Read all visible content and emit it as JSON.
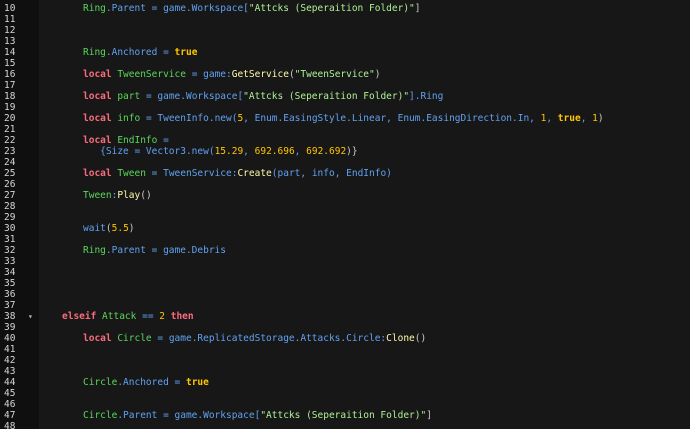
{
  "editor": {
    "lines": [
      {
        "n": "10",
        "tokens": [
          {
            "t": "Ring",
            "c": "idg"
          },
          {
            "t": ".Parent = game.Workspace[",
            "c": "prop"
          },
          {
            "t": "\"Attcks (Seperaition Folder)\"",
            "c": "str"
          },
          {
            "t": "]",
            "c": "punc"
          }
        ]
      },
      {
        "n": "11",
        "tokens": []
      },
      {
        "n": "12",
        "tokens": []
      },
      {
        "n": "13",
        "tokens": []
      },
      {
        "n": "14",
        "tokens": [
          {
            "t": "Ring",
            "c": "idg"
          },
          {
            "t": ".Anchored = ",
            "c": "prop"
          },
          {
            "t": "true",
            "c": "bool"
          }
        ]
      },
      {
        "n": "15",
        "tokens": []
      },
      {
        "n": "16",
        "tokens": [
          {
            "t": "local ",
            "c": "kw"
          },
          {
            "t": "TweenService",
            "c": "idg"
          },
          {
            "t": " = game:",
            "c": "prop"
          },
          {
            "t": "GetService",
            "c": "fn"
          },
          {
            "t": "(",
            "c": "punc"
          },
          {
            "t": "\"TweenService\"",
            "c": "str"
          },
          {
            "t": ")",
            "c": "punc"
          }
        ]
      },
      {
        "n": "17",
        "tokens": []
      },
      {
        "n": "18",
        "tokens": [
          {
            "t": "local ",
            "c": "kw"
          },
          {
            "t": "part",
            "c": "idg"
          },
          {
            "t": " = game.Workspace[",
            "c": "prop"
          },
          {
            "t": "\"Attcks (Seperaition Folder)\"",
            "c": "str"
          },
          {
            "t": "].Ring",
            "c": "prop"
          }
        ]
      },
      {
        "n": "19",
        "tokens": []
      },
      {
        "n": "20",
        "tokens": [
          {
            "t": "local ",
            "c": "kw"
          },
          {
            "t": "info",
            "c": "idg"
          },
          {
            "t": " = TweenInfo.new(",
            "c": "prop"
          },
          {
            "t": "5",
            "c": "num"
          },
          {
            "t": ", Enum.EasingStyle.Linear, Enum.EasingDirection.In, ",
            "c": "prop"
          },
          {
            "t": "1",
            "c": "num"
          },
          {
            "t": ", ",
            "c": "prop"
          },
          {
            "t": "true",
            "c": "bool"
          },
          {
            "t": ", ",
            "c": "prop"
          },
          {
            "t": "1",
            "c": "num"
          },
          {
            "t": ")",
            "c": "punc"
          }
        ]
      },
      {
        "n": "21",
        "tokens": []
      },
      {
        "n": "22",
        "tokens": [
          {
            "t": "local ",
            "c": "kw"
          },
          {
            "t": "EndInfo",
            "c": "idg"
          },
          {
            "t": " =",
            "c": "prop"
          }
        ]
      },
      {
        "n": "23",
        "tokens": [
          {
            "t": "   {Size = Vector3.new(",
            "c": "prop"
          },
          {
            "t": "15.29",
            "c": "num"
          },
          {
            "t": ", ",
            "c": "prop"
          },
          {
            "t": "692.696",
            "c": "num"
          },
          {
            "t": ", ",
            "c": "prop"
          },
          {
            "t": "692.692",
            "c": "num"
          },
          {
            "t": ")}",
            "c": "punc"
          }
        ]
      },
      {
        "n": "24",
        "tokens": []
      },
      {
        "n": "25",
        "tokens": [
          {
            "t": "local ",
            "c": "kw"
          },
          {
            "t": "Tween",
            "c": "idg"
          },
          {
            "t": " = TweenService:",
            "c": "prop"
          },
          {
            "t": "Create",
            "c": "fn"
          },
          {
            "t": "(part, info, EndInfo)",
            "c": "prop"
          }
        ]
      },
      {
        "n": "26",
        "tokens": []
      },
      {
        "n": "27",
        "tokens": [
          {
            "t": "Tween",
            "c": "idg"
          },
          {
            "t": ":",
            "c": "prop"
          },
          {
            "t": "Play",
            "c": "fn"
          },
          {
            "t": "()",
            "c": "punc"
          }
        ]
      },
      {
        "n": "28",
        "tokens": []
      },
      {
        "n": "29",
        "tokens": []
      },
      {
        "n": "30",
        "tokens": [
          {
            "t": "wait",
            "c": "prop"
          },
          {
            "t": "(",
            "c": "punc"
          },
          {
            "t": "5.5",
            "c": "num"
          },
          {
            "t": ")",
            "c": "punc"
          }
        ]
      },
      {
        "n": "31",
        "tokens": []
      },
      {
        "n": "32",
        "tokens": [
          {
            "t": "Ring",
            "c": "idg"
          },
          {
            "t": ".Parent = game.Debris",
            "c": "prop"
          }
        ]
      },
      {
        "n": "33",
        "tokens": []
      },
      {
        "n": "34",
        "tokens": []
      },
      {
        "n": "35",
        "tokens": []
      },
      {
        "n": "36",
        "tokens": []
      },
      {
        "n": "37",
        "tokens": []
      },
      {
        "n": "38",
        "fold": "▾",
        "indent": 0,
        "tokens": [
          {
            "t": "elseif ",
            "c": "kw"
          },
          {
            "t": "Attack",
            "c": "idg"
          },
          {
            "t": " == ",
            "c": "prop"
          },
          {
            "t": "2",
            "c": "num"
          },
          {
            "t": " then",
            "c": "kw"
          }
        ]
      },
      {
        "n": "39",
        "tokens": []
      },
      {
        "n": "40",
        "tokens": [
          {
            "t": "local ",
            "c": "kw"
          },
          {
            "t": "Circle",
            "c": "idg"
          },
          {
            "t": " = game.ReplicatedStorage.Attacks.Circle:",
            "c": "prop"
          },
          {
            "t": "Clone",
            "c": "fn"
          },
          {
            "t": "()",
            "c": "punc"
          }
        ]
      },
      {
        "n": "41",
        "tokens": []
      },
      {
        "n": "42",
        "tokens": []
      },
      {
        "n": "43",
        "tokens": []
      },
      {
        "n": "44",
        "tokens": [
          {
            "t": "Circle",
            "c": "idg"
          },
          {
            "t": ".Anchored = ",
            "c": "prop"
          },
          {
            "t": "true",
            "c": "bool"
          }
        ]
      },
      {
        "n": "45",
        "tokens": []
      },
      {
        "n": "46",
        "tokens": []
      },
      {
        "n": "47",
        "tokens": [
          {
            "t": "Circle",
            "c": "idg"
          },
          {
            "t": ".Parent = game.Workspace[",
            "c": "prop"
          },
          {
            "t": "\"Attcks (Seperaition Folder)\"",
            "c": "str"
          },
          {
            "t": "]",
            "c": "punc"
          }
        ]
      },
      {
        "n": "48",
        "tokens": []
      }
    ]
  }
}
